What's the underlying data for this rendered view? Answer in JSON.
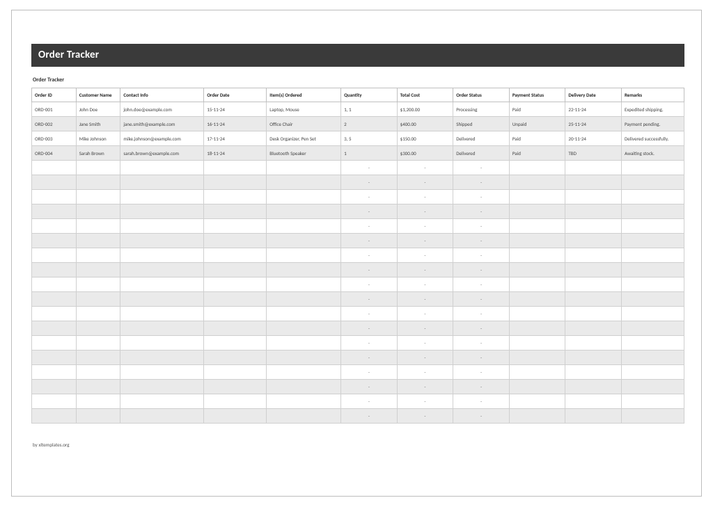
{
  "titleBar": "Order Tracker",
  "subtitle": "Order Tracker",
  "columns": {
    "orderId": "Order ID",
    "customerName": "Customer Name",
    "contactInfo": "Contact Info",
    "orderDate": "Order Date",
    "itemsOrdered": "Item(s) Ordered",
    "quantity": "Quantity",
    "totalCost": "Total Cost",
    "orderStatus": "Order Status",
    "paymentStatus": "Payment Status",
    "deliveryDate": "Delivery Date",
    "remarks": "Remarks"
  },
  "rows": [
    {
      "orderId": "ORD-001",
      "customerName": "John Doe",
      "contactInfo": "john.doe@example.com",
      "orderDate": "15-11-24",
      "itemsOrdered": "Laptop, Mouse",
      "quantity": "1, 1",
      "totalCost": "$1,200.00",
      "orderStatus": "Processing",
      "orderStatusClass": "",
      "paymentStatus": "Paid",
      "paymentStatusClass": "",
      "deliveryDate": "22-11-24",
      "remarks": "Expedited shipping."
    },
    {
      "orderId": "ORD-002",
      "customerName": "Jane Smith",
      "contactInfo": "jane.smith@example.com",
      "orderDate": "16-11-24",
      "itemsOrdered": "Office Chair",
      "quantity": "2",
      "totalCost": "$400.00",
      "orderStatus": "Shipped",
      "orderStatusClass": "",
      "paymentStatus": "Unpaid",
      "paymentStatusClass": "payment-unpaid",
      "deliveryDate": "25-11-24",
      "remarks": "Payment pending."
    },
    {
      "orderId": "ORD-003",
      "customerName": "Mike Johnson",
      "contactInfo": "mike.johnson@example.com",
      "orderDate": "17-11-24",
      "itemsOrdered": "Desk Organizer, Pen Set",
      "quantity": "3, 5",
      "totalCost": "$150.00",
      "orderStatus": "Delivered",
      "orderStatusClass": "status-delivered",
      "paymentStatus": "Paid",
      "paymentStatusClass": "",
      "deliveryDate": "20-11-24",
      "remarks": "Delivered successfully."
    },
    {
      "orderId": "ORD-004",
      "customerName": "Sarah Brown",
      "contactInfo": "sarah.brown@example.com",
      "orderDate": "18-11-24",
      "itemsOrdered": "Bluetooth Speaker",
      "quantity": "1",
      "totalCost": "$300.00",
      "orderStatus": "Delivered",
      "orderStatusClass": "status-delivered",
      "paymentStatus": "Paid",
      "paymentStatusClass": "",
      "deliveryDate": "TBD",
      "remarks": "Awaiting stock."
    }
  ],
  "emptyRowCount": 18,
  "dashPlaceholder": "-",
  "footerCredit": "by xltemplates.org"
}
